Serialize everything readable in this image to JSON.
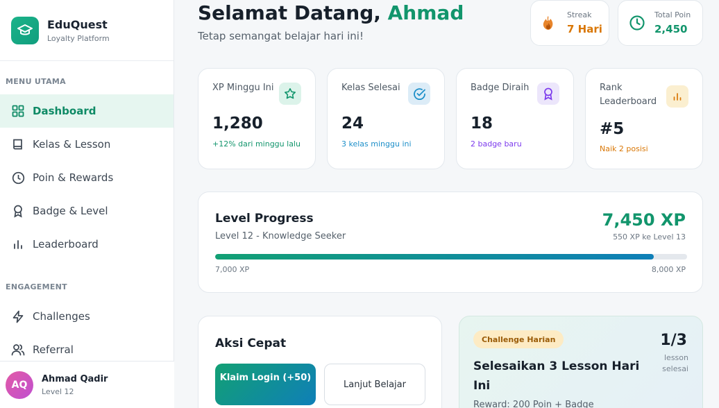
{
  "brand": {
    "name": "EduQuest",
    "subtitle": "Loyalty Platform"
  },
  "sidebar": {
    "sections": [
      {
        "label": "MENU UTAMA"
      },
      {
        "label": "ENGAGEMENT"
      }
    ],
    "items": [
      {
        "label": "Dashboard",
        "icon": "grid-icon",
        "active": true
      },
      {
        "label": "Kelas & Lesson",
        "icon": "book-icon"
      },
      {
        "label": "Poin & Rewards",
        "icon": "clock-icon"
      },
      {
        "label": "Badge & Level",
        "icon": "award-icon"
      },
      {
        "label": "Leaderboard",
        "icon": "bar-chart-icon"
      },
      {
        "label": "Challenges",
        "icon": "lightning-icon"
      },
      {
        "label": "Referral",
        "icon": "users-icon"
      }
    ],
    "user": {
      "initials": "AQ",
      "name": "Ahmad Qadir",
      "level": "Level 12"
    }
  },
  "header": {
    "greeting": "Selamat Datang, ",
    "name": "Ahmad",
    "subtitle": "Tetap semangat belajar hari ini!",
    "streak": {
      "label": "Streak",
      "value": "7 Hari"
    },
    "points": {
      "label": "Total Poin",
      "value": "2,450"
    }
  },
  "stats": [
    {
      "title": "XP Minggu Ini",
      "value": "1,280",
      "note": "+12% dari minggu lalu",
      "icon": "star-icon"
    },
    {
      "title": "Kelas Selesai",
      "value": "24",
      "note": "3 kelas minggu ini",
      "icon": "check-circle-icon"
    },
    {
      "title": "Badge Diraih",
      "value": "18",
      "note": "2 badge baru",
      "icon": "award-icon"
    },
    {
      "title": "Rank Leaderboard",
      "value": "#5",
      "note": "Naik 2 posisi",
      "icon": "bar-chart-icon"
    }
  ],
  "level": {
    "title": "Level Progress",
    "subtitle": "Level 12 - Knowledge Seeker",
    "xp": "7,450 XP",
    "next": "550 XP ke Level 13",
    "min": "7,000 XP",
    "max": "8,000 XP",
    "progress": 0.93
  },
  "quick": {
    "title": "Aksi Cepat",
    "claim": "Klaim Login (+50)",
    "continue": "Lanjut Belajar"
  },
  "challenge": {
    "badge": "Challenge Harian",
    "title": "Selesaikan 3 Lesson Hari Ini",
    "reward": "Reward: 200 Poin + Badge",
    "count": "1/3",
    "count_label": "lesson selesai"
  },
  "colors": {
    "accent": "#12956c",
    "streak": "#d97706",
    "xp_note": "#12956c",
    "class_note": "#1d8fc9",
    "badge_note": "#7c3aed",
    "rank_note": "#d97706"
  }
}
